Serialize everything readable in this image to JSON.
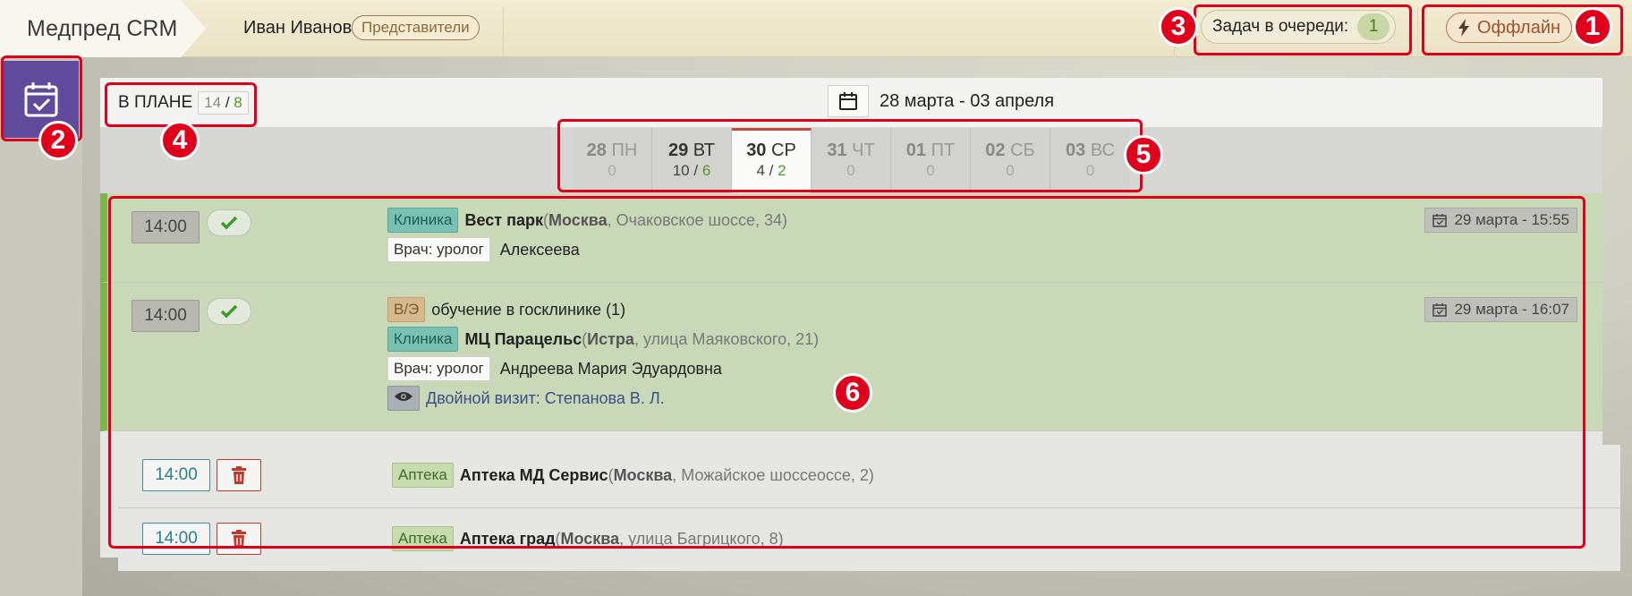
{
  "header": {
    "brand": "Медпред CRM",
    "user_name": "Иван Иванов",
    "user_role": "Представители",
    "queue_label": "Задач в очереди:",
    "queue_count": "1",
    "offline_label": "Оффлайн"
  },
  "sidebar": {
    "items": [
      {
        "icon": "calendar-check-icon",
        "active": true
      }
    ]
  },
  "plan": {
    "label": "В ПЛАНЕ",
    "total": "14",
    "sep": "/",
    "done": "8"
  },
  "week": {
    "icon": "calendar-icon",
    "range": "28 марта - 03 апреля"
  },
  "days": [
    {
      "num": "28",
      "dow": "ПН",
      "total": "0",
      "sep": "",
      "done": ""
    },
    {
      "num": "29",
      "dow": "ВТ",
      "total": "10",
      "sep": " / ",
      "done": "6"
    },
    {
      "num": "30",
      "dow": "СР",
      "total": "4",
      "sep": " / ",
      "done": "2"
    },
    {
      "num": "31",
      "dow": "ЧТ",
      "total": "0",
      "sep": "",
      "done": ""
    },
    {
      "num": "01",
      "dow": "ПТ",
      "total": "0",
      "sep": "",
      "done": ""
    },
    {
      "num": "02",
      "dow": "СБ",
      "total": "0",
      "sep": "",
      "done": ""
    },
    {
      "num": "03",
      "dow": "ВС",
      "total": "0",
      "sep": "",
      "done": ""
    }
  ],
  "visits": [
    {
      "time": "14:00",
      "status": "done",
      "type_tag": "Клиника",
      "name": "Вест парк",
      "addr_open": " (",
      "city": "Москва",
      "street": ", Очаковское шоссе, 34)",
      "doc_tag": "Врач: уролог",
      "doctor": "Алексеева",
      "completed_at": "29 марта - 15:55"
    },
    {
      "time": "14:00",
      "status": "done",
      "extra_tag": "В/Э",
      "extra_text": "обучение в госклинике (1)",
      "type_tag": "Клиника",
      "name": "МЦ Парацельс",
      "addr_open": " (",
      "city": "Истра",
      "street": ", улица Маяковского, 21)",
      "doc_tag": "Врач: уролог",
      "doctor": "Андреева Мария Эдуардовна",
      "dual_visit": "Двойной визит: Степанова В. Л.",
      "completed_at": "29 марта - 16:07"
    },
    {
      "time": "14:00",
      "status": "planned",
      "type_tag": "Аптека",
      "name": "Аптека МД Сервис",
      "addr_open": " (",
      "city": "Москва",
      "street": ", Можайское шоссеоссе, 2)"
    },
    {
      "time": "14:00",
      "status": "planned",
      "type_tag": "Аптека",
      "name": "Аптека град",
      "addr_open": " (",
      "city": "Москва",
      "street": ", улица Багрицкого, 8)"
    }
  ],
  "callouts": [
    "1",
    "2",
    "3",
    "4",
    "5",
    "6"
  ],
  "colors": {
    "accent_red": "#e0001b",
    "sidebar_active": "#5f4a9b",
    "done_row": "#c9d9b8",
    "done_stripe": "#7fb44a",
    "clinic_tag": "#79c2b3",
    "pharmacy_tag": "#c6dcae"
  }
}
